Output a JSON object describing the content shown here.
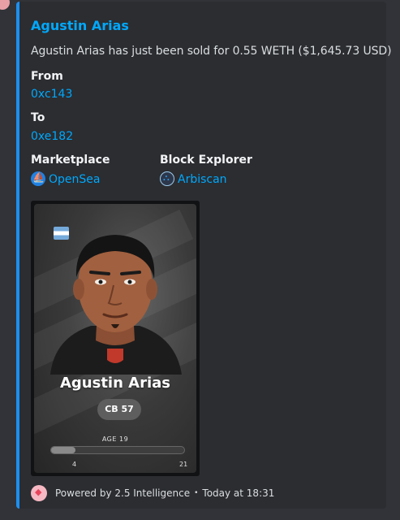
{
  "embed": {
    "title": "Agustin Arias",
    "description": "Agustin Arias has just been sold for 0.55 WETH ($1,645.73 USD)",
    "fields": {
      "from_label": "From",
      "from_value": "0xc143",
      "to_label": "To",
      "to_value": "0xe182",
      "marketplace_label": "Marketplace",
      "marketplace_value": "OpenSea",
      "explorer_label": "Block Explorer",
      "explorer_value": "Arbiscan"
    },
    "accent_color": "#1d8ff0",
    "card": {
      "player_name": "Agustin Arias",
      "position": "CB 57",
      "age_label": "AGE 19",
      "age_min": "4",
      "age_max": "21",
      "age_fraction": 0.18,
      "flag": "argentina-flag",
      "club_crest": "red-shield-crest"
    },
    "footer": {
      "powered_by": "Powered by 2.5 Intelligence",
      "separator": "•",
      "timestamp": "Today at 18:31"
    }
  }
}
